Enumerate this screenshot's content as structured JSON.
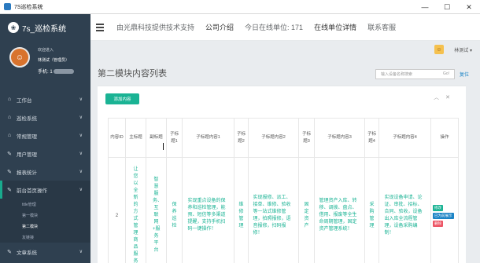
{
  "window": {
    "title": "7S巡检系统",
    "controls": [
      "—",
      "☐",
      "✕"
    ]
  },
  "sidebar": {
    "brand": "7s_巡检系统",
    "profile": {
      "welcome": "欢迎进入",
      "user": "林测试（管理员）",
      "phone_label": "手机: 1"
    },
    "items": [
      {
        "label": "工作台",
        "icon": "home-icon"
      },
      {
        "label": "巡检系统",
        "icon": "home-icon"
      },
      {
        "label": "常规管理",
        "icon": "home-icon"
      },
      {
        "label": "用户管理",
        "icon": "edit-icon"
      },
      {
        "label": "报表统计",
        "icon": "edit-icon"
      },
      {
        "label": "前台首页操作",
        "icon": "edit-icon"
      }
    ],
    "subitems": [
      "title管理",
      "第一模块",
      "第二模块",
      "友链接"
    ],
    "last_item": {
      "label": "文章系统",
      "icon": "edit-icon"
    }
  },
  "topnav": {
    "links": [
      "由光鼎科技提供技术支持",
      "公司介绍",
      "今日在线单位: 171",
      "在线单位详情",
      "联系客服"
    ]
  },
  "userbar": {
    "username": "林测试"
  },
  "page": {
    "title": "第二模块内容列表",
    "search_placeholder": "输入设备名称搜索",
    "search_go": "Go!",
    "reset": "复位",
    "add_button": "添加内容"
  },
  "table": {
    "headers": [
      "内容ID",
      "主标题",
      "副标题",
      "子标题1",
      "子标题内容1",
      "子标题2",
      "子标题内容2",
      "子标题3",
      "子标题内容3",
      "子标题4",
      "子标题内容4",
      "操作"
    ],
    "row": {
      "id": "2",
      "title": "让您以全新的方式管理商品服务",
      "subtitle": "智慧服务、互联网+服务平台",
      "sub1": "保养巡检",
      "content1": "实现重点设备的保养和巡检管理，能预、短信等多渠道提醒，支持手机扫码一键操作！",
      "sub2": "维修管理",
      "content2": "实现报修、派工、接单、维修、验收等一站式维修管理，拍照报修，语音报修，扫码报修！",
      "sub3": "固定资产",
      "content3": "管理资产入库、转移、调拨、盘点、借用、报废等全生命周期管理，固定资产管理系统！",
      "sub4": "采购管理",
      "content4": "实现设备申请、论证、审批、招标、合同、验收，设备出入库全流程管理，设备采购编制！",
      "actions": [
        "修改",
        "已为前展示",
        "删除"
      ]
    }
  },
  "colors": {
    "sidebar": "#2f4050",
    "accent": "#1ab394",
    "info": "#1c84c6",
    "danger": "#ed5565"
  }
}
